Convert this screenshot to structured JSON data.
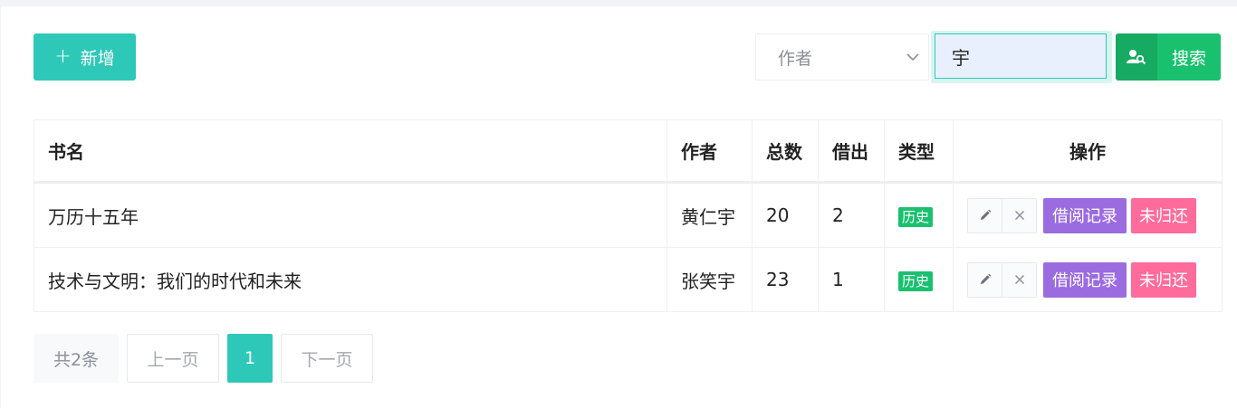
{
  "toolbar": {
    "add_label": "新增",
    "select_value": "作者",
    "search_value": "宇",
    "search_label": "搜索"
  },
  "table": {
    "headers": {
      "title": "书名",
      "author": "作者",
      "total": "总数",
      "borrowed": "借出",
      "type": "类型",
      "actions": "操作"
    },
    "rows": [
      {
        "title": "万历十五年",
        "author": "黄仁宇",
        "total": "20",
        "borrowed": "2",
        "type": "历史",
        "record_label": "借阅记录",
        "unreturned_label": "未归还"
      },
      {
        "title": "技术与文明：我们的时代和未来",
        "author": "张笑宇",
        "total": "23",
        "borrowed": "1",
        "type": "历史",
        "record_label": "借阅记录",
        "unreturned_label": "未归还"
      }
    ]
  },
  "pagination": {
    "total": "共2条",
    "prev": "上一页",
    "current": "1",
    "next": "下一页"
  },
  "colors": {
    "accent": "#2ec8b8",
    "search_green": "#19c16f",
    "tag_green": "#19c16f",
    "record_purple": "#9b6be0",
    "unreturned_pink": "#ff6b9b"
  },
  "icons": [
    "plus-icon",
    "chevron-down-icon",
    "user-search-icon",
    "edit-icon",
    "delete-icon"
  ]
}
